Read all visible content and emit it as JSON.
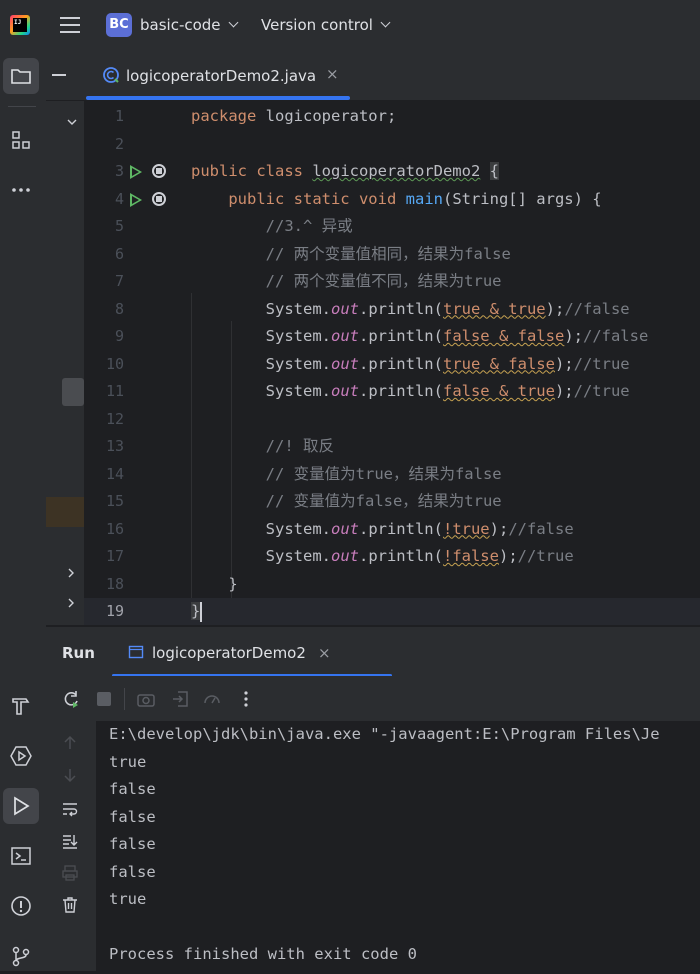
{
  "titlebar": {
    "project_badge": "BC",
    "project_name": "basic-code",
    "vcs_menu": "Version control"
  },
  "editor_tab": {
    "filename": "logicoperatorDemo2.java",
    "close": "×"
  },
  "code_lines": [
    {
      "n": "1",
      "text": "package logicoperator;"
    },
    {
      "n": "2",
      "text": ""
    },
    {
      "n": "3",
      "text": "public class logicoperatorDemo2 {"
    },
    {
      "n": "4",
      "text": "    public static void main(String[] args) {"
    },
    {
      "n": "5",
      "text": "        //3.^ 异或"
    },
    {
      "n": "6",
      "text": "        // 两个变量值相同，结果为false"
    },
    {
      "n": "7",
      "text": "        // 两个变量值不同，结果为true"
    },
    {
      "n": "8",
      "text": "        System.out.println(true & true);//false"
    },
    {
      "n": "9",
      "text": "        System.out.println(false & false);//false"
    },
    {
      "n": "10",
      "text": "        System.out.println(true & false);//true"
    },
    {
      "n": "11",
      "text": "        System.out.println(false & true);//true"
    },
    {
      "n": "12",
      "text": ""
    },
    {
      "n": "13",
      "text": "        //! 取反"
    },
    {
      "n": "14",
      "text": "        // 变量值为true，结果为false"
    },
    {
      "n": "15",
      "text": "        // 变量值为false，结果为true"
    },
    {
      "n": "16",
      "text": "        System.out.println(!true);//false"
    },
    {
      "n": "17",
      "text": "        System.out.println(!false);//true"
    },
    {
      "n": "18",
      "text": "    }"
    },
    {
      "n": "19",
      "text": "}"
    }
  ],
  "run_panel": {
    "title": "Run",
    "tab_label": "logicoperatorDemo2",
    "close": "×"
  },
  "console_lines": [
    "E:\\develop\\jdk\\bin\\java.exe \"-javaagent:E:\\Program Files\\Je",
    "true",
    "false",
    "false",
    "false",
    "false",
    "true",
    "",
    "Process finished with exit code 0"
  ],
  "colors": {
    "accent": "#3574f0",
    "run_green": "#5fb865",
    "keyword": "#cf8e6d",
    "function": "#56a8f5",
    "field": "#c77dbb"
  }
}
